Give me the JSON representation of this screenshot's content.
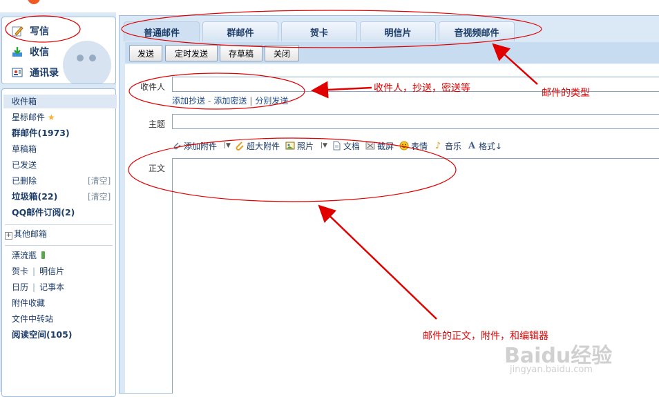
{
  "left": {
    "actions": [
      {
        "label": "写信"
      },
      {
        "label": "收信"
      },
      {
        "label": "通讯录"
      }
    ],
    "folders": {
      "inbox": "收件箱",
      "starred": "星标邮件",
      "group": "群邮件(1973)",
      "drafts": "草稿箱",
      "sent": "已发送",
      "deleted": "已删除",
      "deleted_clear": "[清空]",
      "spam": "垃圾箱(22)",
      "spam_clear": "[清空]",
      "qq_sub": "QQ邮件订阅(2)",
      "other": "其他邮箱",
      "bottle": "漂流瓶",
      "card": "贺卡",
      "postcard": "明信片",
      "calendar": "日历",
      "notes": "记事本",
      "attach_fav": "附件收藏",
      "transfer": "文件中转站",
      "reading": "阅读空间(105)"
    }
  },
  "tabs": [
    "普通邮件",
    "群邮件",
    "贺卡",
    "明信片",
    "音视频邮件"
  ],
  "toolbar": {
    "send": "发送",
    "timed_send": "定时发送",
    "save_draft": "存草稿",
    "close": "关闭"
  },
  "form": {
    "recipient_label": "收件人",
    "add_cc": "添加抄送",
    "add_bcc": "添加密送",
    "separate_send": "分别发送",
    "subject_label": "主题",
    "body_label": "正文"
  },
  "editor": {
    "add_attachment": "添加附件",
    "big_attachment": "超大附件",
    "photo": "照片",
    "doc": "文档",
    "screenshot": "截屏",
    "emoticon": "表情",
    "music": "音乐",
    "format": "格式↓"
  },
  "annotations": {
    "recipients": "收件人，抄送，密送等",
    "types": "邮件的类型",
    "body": "邮件的正文，附件，和编辑器"
  },
  "watermark": {
    "brand": "Baidu经验",
    "url": "jingyan.baidu.com"
  },
  "colors": {
    "annotation": "#e00000",
    "panel": "#dbe9f7",
    "link": "#1c3c68"
  }
}
